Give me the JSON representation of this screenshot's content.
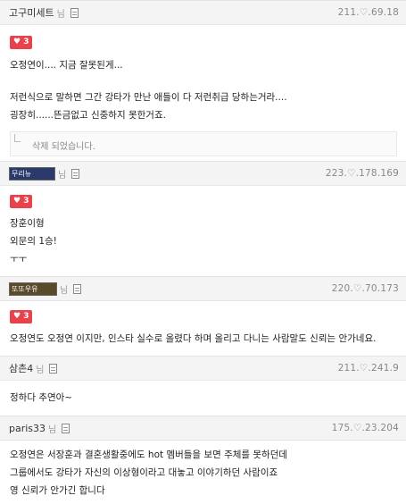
{
  "comments": [
    {
      "author": "고구미세트",
      "nim": "님",
      "ip": "211.♡.69.18",
      "likes": "3",
      "lines": [
        "오정연이.... 지금 잘못된게...",
        "",
        "저런식으로 말하면 그간 강타가 만난 애들이 다 저런취급 당하는거라....",
        "굉장히......뜬금없고 신중하지 못한거죠."
      ],
      "deleted_text": "삭제 되었습니다."
    },
    {
      "author_image_text": "무리뉴",
      "nim": "님",
      "ip": "223.♡.178.169",
      "likes": "3",
      "lines": [
        "장훈이형",
        "외문의 1승!",
        "ㅜㅜ"
      ]
    },
    {
      "author_image_text": "또또우유",
      "nim": "님",
      "ip": "220.♡.70.173",
      "likes": "3",
      "lines": [
        "오정연도 오정연 이지만, 인스타 실수로 올렸다 하며 올리고 다니는 사람말도 신뢰는 안가네요."
      ]
    },
    {
      "author": "삼촌4",
      "nim": "님",
      "ip": "211.♡.241.9",
      "lines": [
        "정하다 추연아~"
      ]
    },
    {
      "author": "paris33",
      "nim": "님",
      "ip": "175.♡.23.204",
      "lines": [
        "오정연은 서장훈과 결혼생활중에도 hot 멤버들을 보면 주체를 못하던데",
        "그룹에서도 강타가 자신의 이상형이라고 대놓고 이야기하던 사람이죠",
        "영 신뢰가 안가긴 합니다"
      ]
    }
  ],
  "colors": {
    "like_badge": "#e8434c",
    "header_bg": "#f4f4f4"
  },
  "icons": {
    "heart": "♥",
    "memo": "memo-icon"
  }
}
